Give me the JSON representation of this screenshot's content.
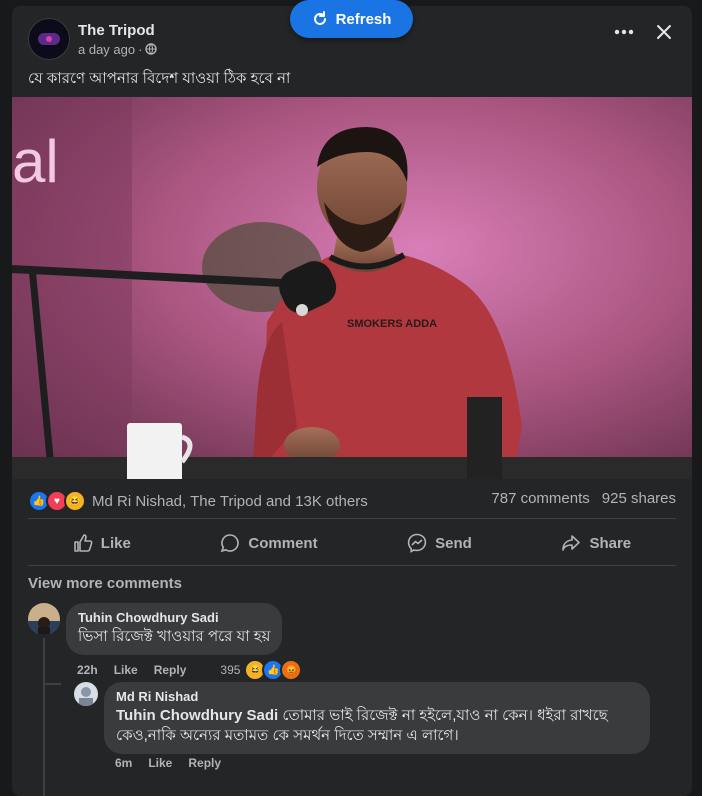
{
  "refresh_label": "Refresh",
  "post": {
    "page_name": "The Tripod",
    "time": "a day ago",
    "text": "যে কারণে আপনার বিদেশ যাওয়া ঠিক হবে না",
    "image_alt": "Man in red t-shirt speaking into a podcast microphone in a pink-lit studio",
    "shirt_text": "SMOKERS ADDA"
  },
  "stats": {
    "reactions_text": "Md Ri Nishad, The Tripod and 13K others",
    "comments": "787 comments",
    "shares": "925 shares"
  },
  "actions": {
    "like": "Like",
    "comment": "Comment",
    "send": "Send",
    "share": "Share"
  },
  "view_more": "View more comments",
  "comments": [
    {
      "name": "Tuhin Chowdhury Sadi",
      "text": "ভিসা রিজেক্ট খাওয়ার পরে যা হয়",
      "time": "22h",
      "like": "Like",
      "reply": "Reply",
      "reaction_count": "395"
    }
  ],
  "reply": {
    "name": "Md Ri Nishad",
    "tag": "Tuhin Chowdhury Sadi",
    "text_line1": "তোমার ভাই রিজেক্ট না হইলে,যাও না কেন। ধইরা রাখছে",
    "text_line2": "কেও,নাকি অন্যের মতামত কে সমর্থন দিতে সম্মান এ লাগে।",
    "time": "6m",
    "like": "Like",
    "reply": "Reply"
  },
  "colors": {
    "accent": "#1b74e4",
    "background": "#242526",
    "bubble": "#3a3b3c"
  }
}
